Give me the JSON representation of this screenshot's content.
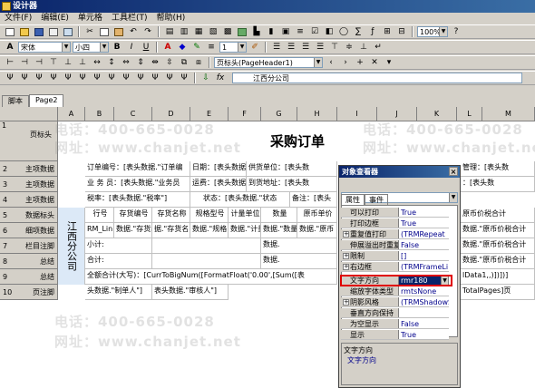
{
  "window": {
    "title": "设计器"
  },
  "menu": [
    "文件(F)",
    "编辑(E)",
    "单元格",
    "工具栏(T)",
    "帮助(H)"
  ],
  "toolbar2": {
    "font": "宋体",
    "size": "小四",
    "bold": "B",
    "italic": "I",
    "underline": "U",
    "line_width": "1",
    "zoom": "100%"
  },
  "toolbar3": {
    "band": "页标头(PageHeader1)"
  },
  "formula_bar": {
    "fx": "fx",
    "value": "江西分公司"
  },
  "tabs": [
    "脚本",
    "Page2"
  ],
  "columns": [
    "A",
    "B",
    "C",
    "D",
    "E",
    "F",
    "G",
    "H",
    "I",
    "J",
    "K",
    "L",
    "M"
  ],
  "rows": [
    "1",
    "2",
    "3",
    "4",
    "5",
    "6",
    "7",
    "8",
    "9",
    "10"
  ],
  "row_labels": [
    "页标头",
    "主项数据",
    "主项数据",
    "主项数据",
    "数据标头",
    "细项数据",
    "栏目注脚",
    "总结",
    "总结",
    "页注脚"
  ],
  "report": {
    "title": "采购订单",
    "company": "江西分公司",
    "r2": "订单编号：[表头数据.\"订单编",
    "r2b": "日期：[表头数据.",
    "r2c": "供货单位：[表头数",
    "r2d": "管理：[表头数",
    "r3": "业 务 员：[表头数据.\"业务员",
    "r3b": "运费：[表头数据.",
    "r3c": "到货地址：[表头数",
    "r3d": "：[表头数",
    "r4": "税率：[表头数据.\"税率\"]",
    "r4b": "状态：[表头数据.\"状态",
    "r4c": "备注：[表头",
    "h5": [
      "行号",
      "存货编号",
      "存货名称",
      "规格型号",
      "计量单位",
      "数量",
      "原币单价",
      "原币价税合计"
    ],
    "r6": "RM_Lin",
    "r6b": "数据.\"存货编",
    "r6c": "据.\"存货名",
    "r6d": "数据.\"规格",
    "r6e": "数据.\"计量",
    "r6f": "数据.\"数量",
    "r6g": "数据.\"原币",
    "r6h": "数据.\"原币价税合计",
    "r7": "小计:",
    "r7b": "数据.",
    "r7c": "数据.\"原币价税合计",
    "r8": "合计:",
    "r8b": "数据.",
    "r8c": "数据.\"原币价税合计",
    "r9": "全额合计(大写)：[CurrToBigNum([FormatFloat('0.00',[Sum([表",
    "r9b": "lData1,,)])])]",
    "r10": "头数据.\"制单人\"]",
    "r10b": "表头数据.\"审核人\"]",
    "r10c": "TotalPages]页"
  },
  "watermarks": [
    "电话：400-665-0028",
    "网址：www.chanjet.net"
  ],
  "inspector": {
    "title": "对象查看器",
    "tabs": [
      "属性",
      "事件"
    ],
    "props": [
      {
        "name": "可以打印",
        "value": "True"
      },
      {
        "name": "打印边框",
        "value": "True"
      },
      {
        "name": "重复值打印",
        "value": "(TRMRepeat"
      },
      {
        "name": "伸展溢出时重复",
        "value": "False"
      },
      {
        "name": "限制",
        "value": "[]"
      },
      {
        "name": "右边框",
        "value": "(TRMFrameLi"
      },
      {
        "name": "文字方向",
        "value": "rmr180"
      },
      {
        "name": "缩放字体类型",
        "value": "rmtsNone"
      },
      {
        "name": "阴影风格",
        "value": "(TRMShadowStyle)"
      },
      {
        "name": "垂直方向保持",
        "value": ""
      },
      {
        "name": "为空显示",
        "value": "False"
      },
      {
        "name": "显示",
        "value": "True"
      }
    ],
    "desc_title": "文字方向",
    "desc_body": "文字方向"
  }
}
